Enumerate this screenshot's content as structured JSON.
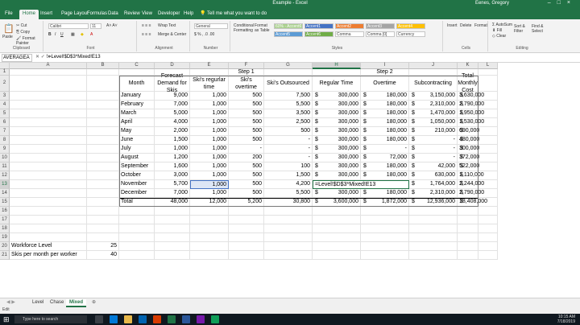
{
  "window": {
    "title": "Example - Excel",
    "user": "Eenes, Gregory"
  },
  "ribbon_tabs": [
    "File",
    "Home",
    "Insert",
    "Page Layout",
    "Formulas",
    "Data",
    "Review",
    "View",
    "Developer",
    "Help",
    "Tell me what you want to do"
  ],
  "ribbon": {
    "clipboard": {
      "label": "Clipboard",
      "paste": "Paste",
      "cut": "Cut",
      "copy": "Copy",
      "format_painter": "Format Painter"
    },
    "font": {
      "label": "Font",
      "name": "Calibri",
      "size": "11"
    },
    "alignment": {
      "label": "Alignment",
      "wrap": "Wrap Text",
      "merge": "Merge & Center"
    },
    "number": {
      "label": "Number",
      "format": "General"
    },
    "styles": {
      "label": "Styles",
      "cond": "Conditional Formatting",
      "table": "Format as Table",
      "items": [
        "60% - Accent6",
        "Accent1",
        "Accent2",
        "Accent3",
        "Accent4",
        "Accent5",
        "Accent6",
        "Comma",
        "Comma [0]",
        "Currency"
      ]
    },
    "cells": {
      "label": "Cells",
      "insert": "Insert",
      "delete": "Delete",
      "format": "Format"
    },
    "editing": {
      "label": "Editing",
      "autosum": "AutoSum",
      "fill": "Fill",
      "clear": "Clear",
      "sort": "Sort & Filter",
      "find": "Find & Select"
    }
  },
  "formula_bar": {
    "name_box": "AVERAGEA",
    "formula": "=Level!$D$3*Mixed!E13"
  },
  "columns": [
    "A",
    "B",
    "C",
    "D",
    "E",
    "F",
    "G",
    "H",
    "I",
    "J",
    "K",
    "L"
  ],
  "headers": {
    "step1": "Step 1",
    "step2": "Step 2",
    "month": "Month",
    "forecast": "Forecast Demand for Skis",
    "regular": "Ski's regurlar time",
    "overtime": "Ski's overtime",
    "outsourced": "Ski's Outsourced",
    "reg_time": "Regular Time",
    "ot": "Overtime",
    "sub": "Subcontracting",
    "total": "Total Monthly Cost"
  },
  "rows": [
    {
      "m": "January",
      "d": "9,000",
      "e": "1,000",
      "f": "500",
      "g": "7,500",
      "h": "300,000",
      "i": "180,000",
      "j": "3,150,000",
      "k": "3,630,000"
    },
    {
      "m": "February",
      "d": "7,000",
      "e": "1,000",
      "f": "500",
      "g": "5,500",
      "h": "300,000",
      "i": "180,000",
      "j": "2,310,000",
      "k": "2,790,000"
    },
    {
      "m": "March",
      "d": "5,000",
      "e": "1,000",
      "f": "500",
      "g": "3,500",
      "h": "300,000",
      "i": "180,000",
      "j": "1,470,000",
      "k": "1,950,000"
    },
    {
      "m": "April",
      "d": "4,000",
      "e": "1,000",
      "f": "500",
      "g": "2,500",
      "h": "300,000",
      "i": "180,000",
      "j": "1,050,000",
      "k": "1,530,000"
    },
    {
      "m": "May",
      "d": "2,000",
      "e": "1,000",
      "f": "500",
      "g": "500",
      "h": "300,000",
      "i": "180,000",
      "j": "210,000",
      "k": "690,000"
    },
    {
      "m": "June",
      "d": "1,500",
      "e": "1,000",
      "f": "500",
      "g": "-",
      "h": "300,000",
      "i": "180,000",
      "j": "-",
      "k": "480,000"
    },
    {
      "m": "July",
      "d": "1,000",
      "e": "1,000",
      "f": "-",
      "g": "-",
      "h": "300,000",
      "i": "-",
      "j": "-",
      "k": "300,000"
    },
    {
      "m": "August",
      "d": "1,200",
      "e": "1,000",
      "f": "200",
      "g": "-",
      "h": "300,000",
      "i": "72,000",
      "j": "-",
      "k": "372,000"
    },
    {
      "m": "September",
      "d": "1,600",
      "e": "1,000",
      "f": "500",
      "g": "100",
      "h": "300,000",
      "i": "180,000",
      "j": "42,000",
      "k": "522,000"
    },
    {
      "m": "October",
      "d": "3,000",
      "e": "1,000",
      "f": "500",
      "g": "1,500",
      "h": "300,000",
      "i": "180,000",
      "j": "630,000",
      "k": "1,110,000"
    },
    {
      "m": "November",
      "d": "5,700",
      "e": "1,000",
      "f": "500",
      "g": "4,200",
      "h": "=Level!$D$3*Mixed!E13",
      "i": "",
      "j": "1,764,000",
      "k": "2,244,000"
    },
    {
      "m": "December",
      "d": "7,000",
      "e": "1,000",
      "f": "500",
      "g": "5,500",
      "h": "300,000",
      "i": "180,000",
      "j": "2,310,000",
      "k": "2,790,000"
    },
    {
      "m": "Total",
      "d": "48,000",
      "e": "12,000",
      "f": "5,200",
      "g": "30,800",
      "h": "3,600,000",
      "i": "1,872,000",
      "j": "12,936,000",
      "k": "18,408,000"
    }
  ],
  "extras": {
    "r19a": "Workforce Level",
    "r19b": "25",
    "r20a": "Skis per month per worker",
    "r20b": "40"
  },
  "sheets": [
    "Level",
    "Chase",
    "Mixed"
  ],
  "status": "Edit",
  "clock": {
    "time": "10:15 AM",
    "date": "7/18/2019"
  },
  "search_placeholder": "Type here to search"
}
